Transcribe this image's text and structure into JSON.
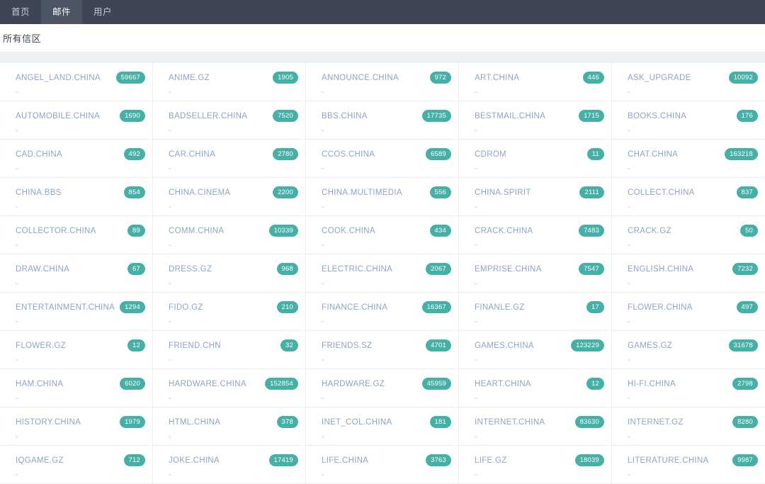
{
  "navbar": {
    "items": [
      {
        "label": "首页",
        "active": false
      },
      {
        "label": "邮件",
        "active": true
      },
      {
        "label": "用户",
        "active": false
      }
    ]
  },
  "page": {
    "title": "所有信区"
  },
  "colors": {
    "navbar_bg": "#3e4653",
    "navbar_active_bg": "#4c5563",
    "band_bg": "#edf0f3",
    "badge_bg": "#45b0a5",
    "link": "#8ea4c6",
    "divider": "#eceef0"
  },
  "boards": {
    "columns": 5,
    "placeholder_desc": "-",
    "items": [
      {
        "name": "ANGEL_LAND.CHINA",
        "count": "59667",
        "desc": "-"
      },
      {
        "name": "ANIME.GZ",
        "count": "1905",
        "desc": "-"
      },
      {
        "name": "ANNOUNCE.CHINA",
        "count": "972",
        "desc": "-"
      },
      {
        "name": "ART.CHINA",
        "count": "446",
        "desc": "-"
      },
      {
        "name": "ASK_UPGRADE",
        "count": "10092",
        "desc": "-"
      },
      {
        "name": "AUTOMOBILE.CHINA",
        "count": "1690",
        "desc": "-"
      },
      {
        "name": "BADSELLER.CHINA",
        "count": "7520",
        "desc": "-"
      },
      {
        "name": "BBS.CHINA",
        "count": "17735",
        "desc": "-"
      },
      {
        "name": "BESTMAIL.CHINA",
        "count": "1715",
        "desc": "-"
      },
      {
        "name": "BOOKS.CHINA",
        "count": "176",
        "desc": "-"
      },
      {
        "name": "CAD.CHINA",
        "count": "492",
        "desc": "-"
      },
      {
        "name": "CAR.CHINA",
        "count": "2780",
        "desc": "-"
      },
      {
        "name": "CCOS.CHINA",
        "count": "6589",
        "desc": "-"
      },
      {
        "name": "CDROM",
        "count": "11",
        "desc": "-"
      },
      {
        "name": "CHAT.CHINA",
        "count": "163218",
        "desc": "-"
      },
      {
        "name": "CHINA.BBS",
        "count": "854",
        "desc": "-"
      },
      {
        "name": "CHINA.CINEMA",
        "count": "2200",
        "desc": "-"
      },
      {
        "name": "CHINA.MULTIMEDIA",
        "count": "556",
        "desc": "-"
      },
      {
        "name": "CHINA.SPIRIT",
        "count": "2111",
        "desc": "-"
      },
      {
        "name": "COLLECT.CHINA",
        "count": "837",
        "desc": "-"
      },
      {
        "name": "COLLECTOR.CHINA",
        "count": "89",
        "desc": "-"
      },
      {
        "name": "COMM.CHINA",
        "count": "10339",
        "desc": "-"
      },
      {
        "name": "COOK.CHINA",
        "count": "434",
        "desc": "-"
      },
      {
        "name": "CRACK.CHINA",
        "count": "7483",
        "desc": "-"
      },
      {
        "name": "CRACK.GZ",
        "count": "50",
        "desc": "-"
      },
      {
        "name": "DRAW.CHINA",
        "count": "67",
        "desc": "-"
      },
      {
        "name": "DRESS.GZ",
        "count": "968",
        "desc": "-"
      },
      {
        "name": "ELECTRIC.CHINA",
        "count": "2067",
        "desc": "-"
      },
      {
        "name": "EMPRISE.CHINA",
        "count": "7547",
        "desc": "-"
      },
      {
        "name": "ENGLISH.CHINA",
        "count": "7232",
        "desc": "-"
      },
      {
        "name": "ENTERTAINMENT.CHINA",
        "count": "1294",
        "desc": "-"
      },
      {
        "name": "FIDO.GZ",
        "count": "210",
        "desc": "-"
      },
      {
        "name": "FINANCE.CHINA",
        "count": "16367",
        "desc": "-"
      },
      {
        "name": "FINANLE.GZ",
        "count": "17",
        "desc": "-"
      },
      {
        "name": "FLOWER.CHINA",
        "count": "497",
        "desc": "-"
      },
      {
        "name": "FLOWER.GZ",
        "count": "12",
        "desc": "-"
      },
      {
        "name": "FRIEND.CHN",
        "count": "32",
        "desc": "-"
      },
      {
        "name": "FRIENDS.SZ",
        "count": "4701",
        "desc": "-"
      },
      {
        "name": "GAMES.CHINA",
        "count": "123229",
        "desc": "-"
      },
      {
        "name": "GAMES.GZ",
        "count": "31678",
        "desc": "-"
      },
      {
        "name": "HAM.CHINA",
        "count": "6020",
        "desc": "-"
      },
      {
        "name": "HARDWARE.CHINA",
        "count": "152854",
        "desc": "-"
      },
      {
        "name": "HARDWARE.GZ",
        "count": "45959",
        "desc": "-"
      },
      {
        "name": "HEART.CHINA",
        "count": "12",
        "desc": "-"
      },
      {
        "name": "HI-FI.CHINA",
        "count": "2798",
        "desc": "-"
      },
      {
        "name": "HISTORY.CHINA",
        "count": "1979",
        "desc": "-"
      },
      {
        "name": "HTML.CHINA",
        "count": "378",
        "desc": "-"
      },
      {
        "name": "INET_COL.CHINA",
        "count": "181",
        "desc": "-"
      },
      {
        "name": "INTERNET.CHINA",
        "count": "83630",
        "desc": "-"
      },
      {
        "name": "INTERNET.GZ",
        "count": "8280",
        "desc": "-"
      },
      {
        "name": "IQGAME.GZ",
        "count": "712",
        "desc": "-"
      },
      {
        "name": "JOKE.CHINA",
        "count": "17419",
        "desc": "-"
      },
      {
        "name": "LIFE.CHINA",
        "count": "3763",
        "desc": "-"
      },
      {
        "name": "LIFE.GZ",
        "count": "18039",
        "desc": "-"
      },
      {
        "name": "LITERATURE.CHINA",
        "count": "9987",
        "desc": "-"
      }
    ]
  }
}
